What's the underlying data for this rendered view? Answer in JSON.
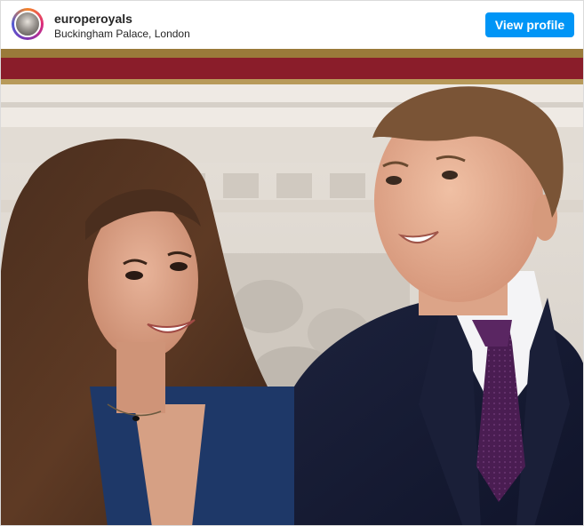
{
  "post": {
    "username": "europeroyals",
    "location": "Buckingham Palace, London",
    "view_profile_label": "View profile"
  },
  "colors": {
    "accent": "#0095f6",
    "username_text": "#262626",
    "curtain_red": "#8a1d2a",
    "suit_navy": "#161b33",
    "dress_blue": "#1e3868",
    "tie_purple": "#4a1d52"
  },
  "icons": {
    "avatar": "profile-picture"
  }
}
